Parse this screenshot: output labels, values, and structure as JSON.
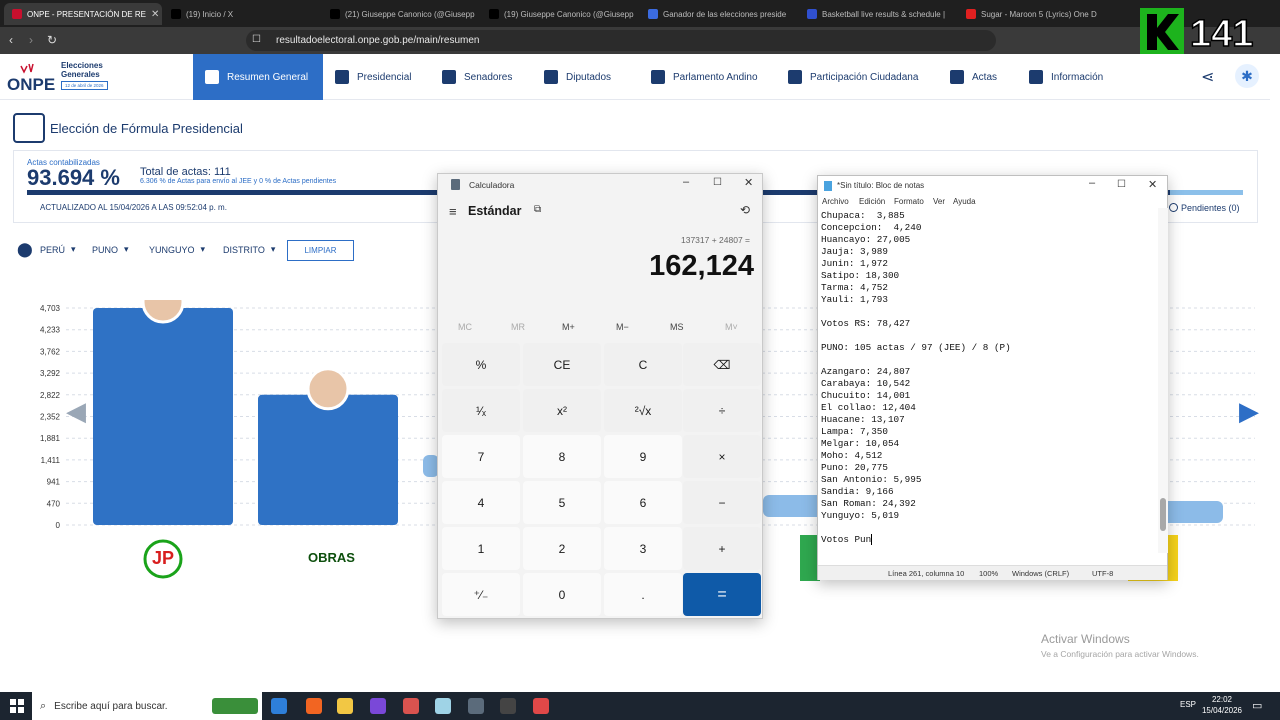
{
  "browser": {
    "tabs": [
      {
        "title": "ONPE - PRESENTACIÓN DE RE",
        "active": true,
        "color": "#c8102e"
      },
      {
        "title": "(19) Inicio / X",
        "active": false,
        "color": "#000000"
      },
      {
        "title": "(21) Giuseppe Canonico (@Giusepp",
        "active": false,
        "color": "#000000"
      },
      {
        "title": "(19) Giuseppe Canonico (@Giusepp",
        "active": false,
        "color": "#000000"
      },
      {
        "title": "Ganador de las elecciones preside",
        "active": false,
        "color": "#3b6be0"
      },
      {
        "title": "Basketball live results & schedule |",
        "active": false,
        "color": "#3050d0"
      },
      {
        "title": "Sugar - Maroon 5 (Lyrics) One D",
        "active": false,
        "color": "#e02020"
      }
    ],
    "url": "resultadoelectoral.onpe.gob.pe/main/resumen",
    "overlay_logo": "141"
  },
  "site": {
    "logo": "ONPE",
    "logo_sub": "Elecciones Generales",
    "logo_date": "12 de abril de 2026",
    "nav": [
      {
        "label": "Resumen General",
        "active": true
      },
      {
        "label": "Presidencial"
      },
      {
        "label": "Senadores"
      },
      {
        "label": "Diputados"
      },
      {
        "label": "Parlamento Andino"
      },
      {
        "label": "Participación Ciudadana"
      },
      {
        "label": "Actas"
      },
      {
        "label": "Información"
      }
    ],
    "page_title": "Elección de Fórmula Presidencial",
    "summary": {
      "actas_label": "Actas contabilizadas",
      "actas_pct": "93.694 %",
      "actas_pct_value": 93.694,
      "total_actas": "Total de actas: 111",
      "pending_note": "6.306 % de Actas para envío al JEE y 0 % de Actas pendientes",
      "updated": "ACTUALIZADO AL 15/04/2026 A LAS 09:52:04 p. m.",
      "pendientes": "Pendientes (0)"
    },
    "filters": [
      "PERÚ",
      "PUNO",
      "YUNGUYO",
      "DISTRITO"
    ],
    "clear_button": "LIMPIAR",
    "party_label_obras": "OBRAS",
    "party_label_jp": "JP"
  },
  "chart_data": {
    "type": "bar",
    "ytick_labels": [
      "0",
      "470",
      "941",
      "1,411",
      "1,881",
      "2,352",
      "2,822",
      "3,292",
      "3,762",
      "4,233",
      "4,703"
    ],
    "ylim": [
      0,
      4703
    ],
    "bars": [
      {
        "party": "JP",
        "value": 4703
      },
      {
        "party": "OBRAS",
        "value": 2822
      }
    ]
  },
  "calculator": {
    "title": "Calculadora",
    "mode": "Estándar",
    "expression": "137317 + 24807 =",
    "display": "162,124",
    "memory": [
      "MC",
      "MR",
      "M+",
      "M−",
      "MS",
      "M˅"
    ],
    "keys": [
      [
        "%",
        "CE",
        "C",
        "⌫"
      ],
      [
        "¹⁄ₓ",
        "x²",
        "²√x",
        "÷"
      ],
      [
        "7",
        "8",
        "9",
        "×"
      ],
      [
        "4",
        "5",
        "6",
        "−"
      ],
      [
        "1",
        "2",
        "3",
        "+"
      ],
      [
        "⁺⁄₋",
        "0",
        ".",
        "="
      ]
    ]
  },
  "notepad": {
    "title": "*Sin título: Bloc de notas",
    "menu": [
      "Archivo",
      "Edición",
      "Formato",
      "Ver",
      "Ayuda"
    ],
    "content": "Chupaca:  3,885\nConcepcion:  4,240\nHuancayo: 27,005\nJauja: 3,989\nJunin: 1,972\nSatipo: 18,300\nTarma: 4,752\nYauli: 1,793\n\nVotos RS: 78,427\n\nPUNO: 105 actas / 97 (JEE) / 8 (P)\n\nAzangaro: 24,807\nCarabaya: 10,542\nChucuito: 14,001\nEl collao: 12,404\nHuacane: 13,107\nLampa: 7,350\nMelgar: 10,054\nMoho: 4,512\nPuno: 20,775\nSan Antonio: 5,995\nSandia: 9,166\nSan Roman: 24,392\nYunguyo: 5,019\n\nVotos Pun",
    "status_line": "Línea 261, columna 10",
    "status_zoom": "100%",
    "status_eol": "Windows (CRLF)",
    "status_enc": "UTF-8"
  },
  "watermark": {
    "title": "Activar Windows",
    "subtitle": "Ve a Configuración para activar Windows."
  },
  "taskbar": {
    "search": "Escribe aquí para buscar.",
    "lang": "ESP",
    "time": "22:02",
    "date": "15/04/2026"
  }
}
